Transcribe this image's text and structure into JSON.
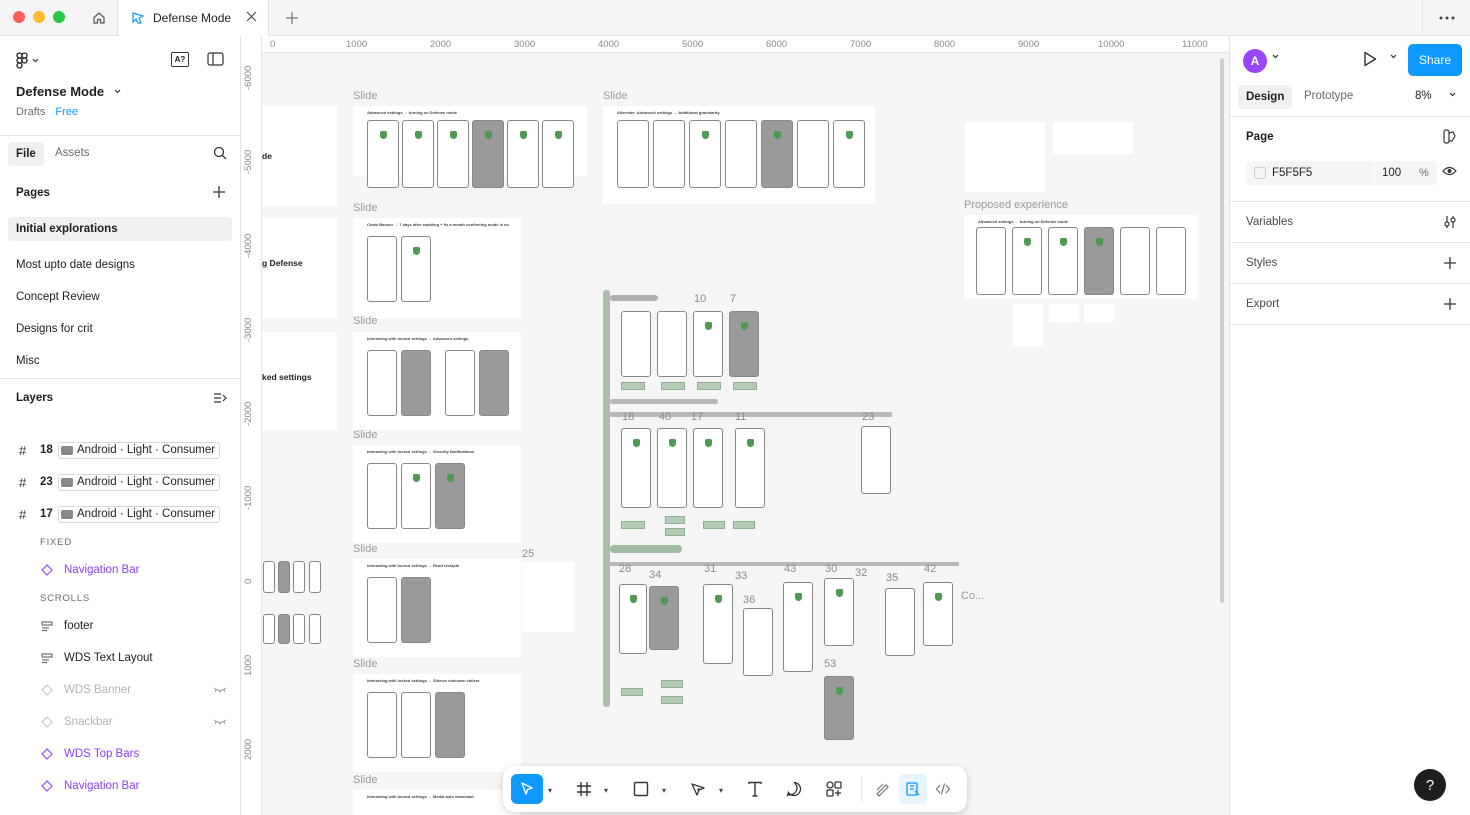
{
  "tab": {
    "title": "Defense Mode"
  },
  "file": {
    "name": "Defense Mode",
    "location": "Drafts",
    "plan": "Free"
  },
  "left_tabs": {
    "file": "File",
    "assets": "Assets"
  },
  "pages": {
    "heading": "Pages",
    "items": [
      {
        "label": "Initial explorations",
        "active": true
      },
      {
        "label": "Most upto date designs"
      },
      {
        "label": "Concept Review"
      },
      {
        "label": "Designs for crit"
      },
      {
        "label": "Misc"
      }
    ]
  },
  "layers": {
    "heading": "Layers",
    "frames": [
      {
        "num": "18",
        "label": "Android · Light · Consumer"
      },
      {
        "num": "23",
        "label": "Android · Light · Consumer"
      },
      {
        "num": "17",
        "label": "Android · Light · Consumer"
      }
    ],
    "section_fixed": "FIXED",
    "section_scrolls": "SCROLLS",
    "items": [
      {
        "label": "Navigation Bar",
        "style": "purple"
      },
      {
        "label": "footer",
        "style": "normal"
      },
      {
        "label": "WDS Text Layout",
        "style": "normal"
      },
      {
        "label": "WDS Banner",
        "style": "muted"
      },
      {
        "label": "Snackbar",
        "style": "muted"
      },
      {
        "label": "WDS Top Bars",
        "style": "purple"
      },
      {
        "label": "Navigation Bar",
        "style": "purple"
      }
    ]
  },
  "ruler": {
    "top": [
      "0",
      "1000",
      "2000",
      "3000",
      "4000",
      "5000",
      "6000",
      "7000",
      "8000",
      "9000",
      "10000",
      "11000"
    ],
    "left": [
      "-6000",
      "-5000",
      "-4000",
      "-3000",
      "-2000",
      "-1000",
      "0",
      "1000",
      "2000"
    ]
  },
  "canvas": {
    "slide_label": "Slide",
    "proposed_label": "Proposed experience",
    "partial_labels": [
      "de",
      "g Defense",
      "ked settings"
    ],
    "slide_titles": [
      "Advanced settings → turning on Defense mode",
      "Alternate: Advanced settings → Additional granularity",
      "Chats Banner → 7 days after enabling + fix a month confirming mode is on",
      "Interacting with locked settings → Advanced settings",
      "Interacting with locked settings → Security Notifications",
      "Interacting with locked settings → Read receipts",
      "Interacting with locked settings → Silence unknown callers",
      "Interacting with locked settings → Media auto download",
      "Advanced settings → turning on Defense mode"
    ],
    "flow_numbers": [
      "10",
      "7",
      "18",
      "40",
      "17",
      "11",
      "23",
      "25",
      "28",
      "34",
      "31",
      "33",
      "36",
      "43",
      "30",
      "32",
      "35",
      "42",
      "53"
    ],
    "overflow_label": "Co..."
  },
  "right": {
    "avatar_initial": "A",
    "share_label": "Share",
    "tab_design": "Design",
    "tab_prototype": "Prototype",
    "zoom": "8%",
    "page_heading": "Page",
    "page_color_hex": "F5F5F5",
    "page_opacity": "100",
    "percent": "%",
    "variables": "Variables",
    "styles": "Styles",
    "export": "Export"
  },
  "help_label": "?",
  "colors": {
    "accent": "#0d99ff",
    "purple": "#8a3ffc",
    "canvas": "#f5f5f5",
    "flow_green": "#b4ccb5"
  },
  "toolbar_icons": [
    "move-tool",
    "frame-tool",
    "shape-tool",
    "pen-tool",
    "text-tool",
    "comment-tool",
    "actions-tool",
    "draw-tool",
    "dev-mode-toggle",
    "code-tool"
  ]
}
